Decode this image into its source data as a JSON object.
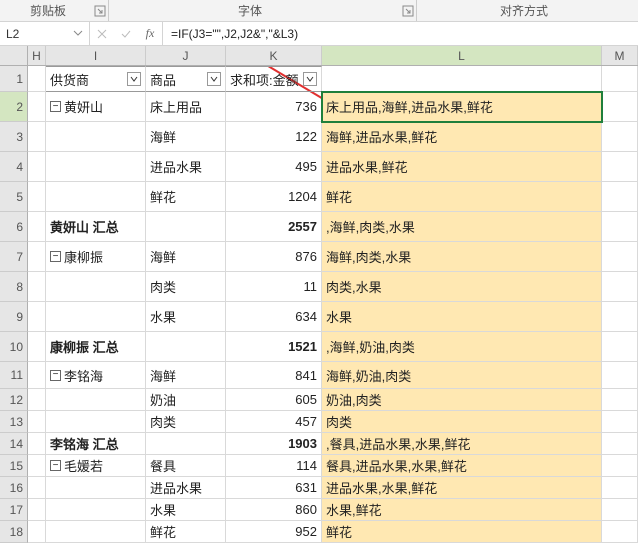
{
  "ribbon": {
    "group_clipboard": "剪贴板",
    "group_font": "字体",
    "group_align": "对齐方式"
  },
  "name_box": "L2",
  "formula": "=IF(J3=\"\",J2,J2&\",\"&L3)",
  "columns": {
    "H": "H",
    "I": "I",
    "J": "J",
    "K": "K",
    "L": "L",
    "M": "M"
  },
  "headers": {
    "I": "供货商",
    "J": "商品",
    "K": "求和项:金额"
  },
  "rows": [
    {
      "n": "1",
      "header": true
    },
    {
      "n": "2",
      "I": "黄妍山",
      "outline": true,
      "J": "床上用品",
      "K": "736",
      "L": "床上用品,海鲜,进品水果,鲜花",
      "active_row": true
    },
    {
      "n": "3",
      "I": "",
      "J": "海鲜",
      "K": "122",
      "L": "海鲜,进品水果,鲜花"
    },
    {
      "n": "4",
      "I": "",
      "J": "进品水果",
      "K": "495",
      "L": "进品水果,鲜花"
    },
    {
      "n": "5",
      "I": "",
      "J": "鲜花",
      "K": "1204",
      "L": "鲜花"
    },
    {
      "n": "6",
      "I": "黄妍山 汇总",
      "bold": true,
      "J": "",
      "K": "2557",
      "L": ",海鲜,肉类,水果"
    },
    {
      "n": "7",
      "I": "康柳振",
      "outline": true,
      "J": "海鲜",
      "K": "876",
      "L": "海鲜,肉类,水果"
    },
    {
      "n": "8",
      "I": "",
      "J": "肉类",
      "K": "11",
      "L": "肉类,水果"
    },
    {
      "n": "9",
      "I": "",
      "J": "水果",
      "K": "634",
      "L": "水果"
    },
    {
      "n": "10",
      "I": "康柳振 汇总",
      "bold": true,
      "J": "",
      "K": "1521",
      "L": ",海鲜,奶油,肉类"
    },
    {
      "n": "11",
      "I": "李铭海",
      "outline": true,
      "J": "海鲜",
      "K": "841",
      "L": "海鲜,奶油,肉类"
    },
    {
      "n": "12",
      "I": "",
      "J": "奶油",
      "K": "605",
      "L": "奶油,肉类",
      "short": true
    },
    {
      "n": "13",
      "I": "",
      "J": "肉类",
      "K": "457",
      "L": "肉类",
      "short": true
    },
    {
      "n": "14",
      "I": "李铭海 汇总",
      "bold": true,
      "J": "",
      "K": "1903",
      "L": ",餐具,进品水果,水果,鲜花",
      "short": true
    },
    {
      "n": "15",
      "I": "毛媛若",
      "outline": true,
      "J": "餐具",
      "K": "114",
      "L": "餐具,进品水果,水果,鲜花",
      "short": true
    },
    {
      "n": "16",
      "I": "",
      "J": "进品水果",
      "K": "631",
      "L": "进品水果,水果,鲜花",
      "short": true
    },
    {
      "n": "17",
      "I": "",
      "J": "水果",
      "K": "860",
      "L": "水果,鲜花",
      "short": true
    },
    {
      "n": "18",
      "I": "",
      "J": "鲜花",
      "K": "952",
      "L": "鲜花",
      "short": true
    }
  ]
}
